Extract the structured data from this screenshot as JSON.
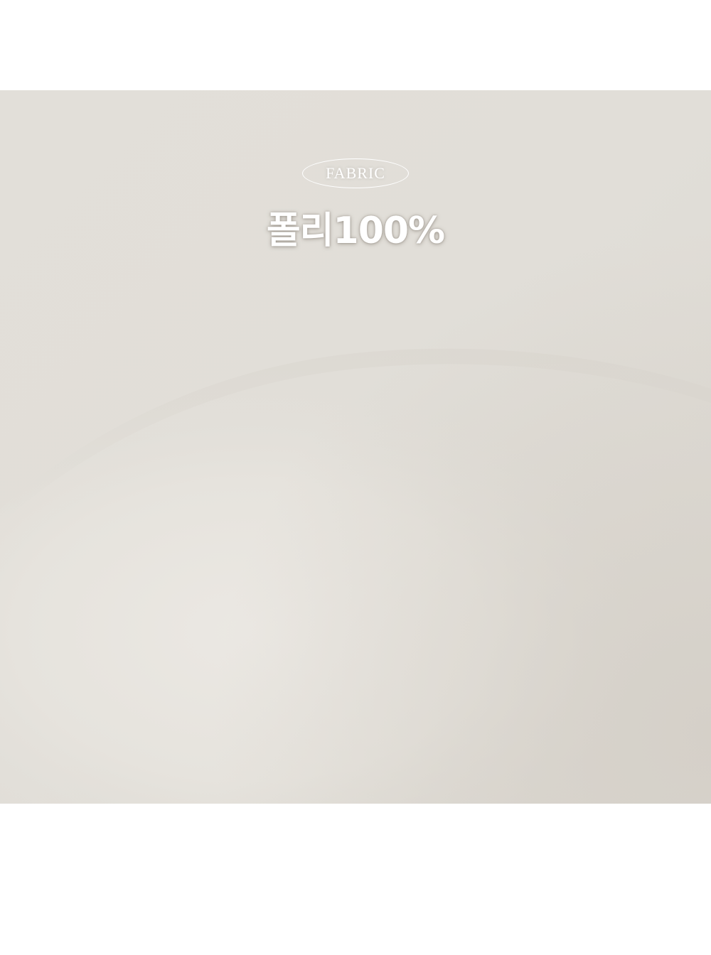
{
  "badge": {
    "label": "FABRIC"
  },
  "composition": {
    "text": "폴리100%"
  },
  "colors": {
    "fabric_base": "#e3e0da",
    "fabric_highlight": "#ece9e4",
    "fabric_shadow": "#d7d3cc",
    "text": "#ffffff",
    "page_background": "#ffffff"
  }
}
